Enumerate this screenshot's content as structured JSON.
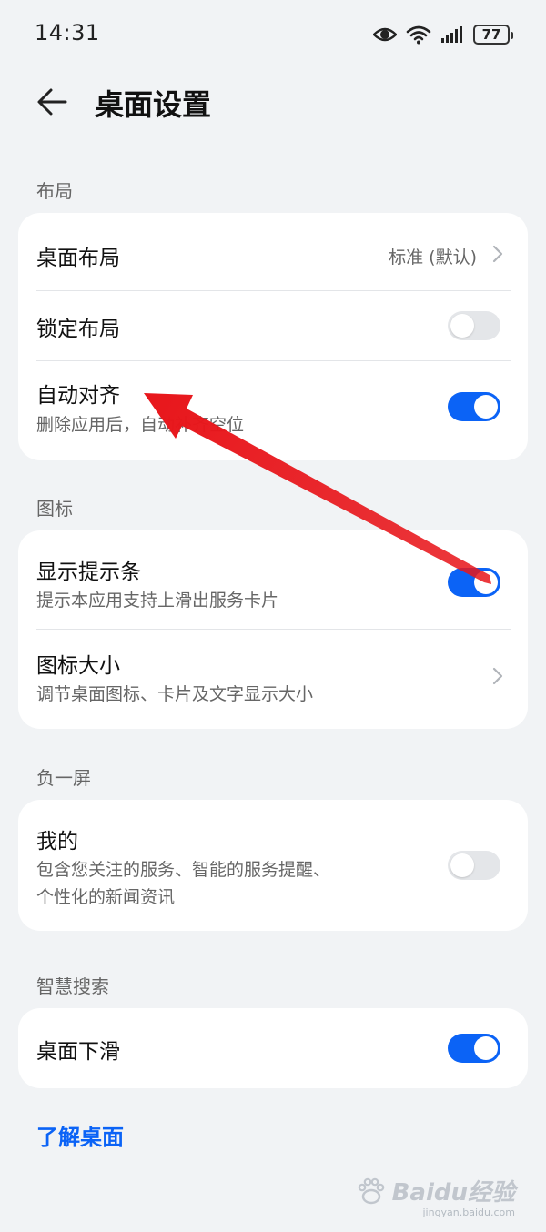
{
  "status_bar": {
    "time": "14:31",
    "battery": "77"
  },
  "header": {
    "title": "桌面设置"
  },
  "sections": {
    "layout": {
      "label": "布局",
      "rows": {
        "desktop_layout": {
          "title": "桌面布局",
          "value": "标准 (默认)"
        },
        "lock_layout": {
          "title": "锁定布局",
          "toggle": false
        },
        "auto_align": {
          "title": "自动对齐",
          "subtitle": "删除应用后，自动补齐空位",
          "toggle": true
        }
      }
    },
    "icons": {
      "label": "图标",
      "rows": {
        "show_hint_bar": {
          "title": "显示提示条",
          "subtitle": "提示本应用支持上滑出服务卡片",
          "toggle": true
        },
        "icon_size": {
          "title": "图标大小",
          "subtitle": "调节桌面图标、卡片及文字显示大小"
        }
      }
    },
    "minus_one": {
      "label": "负一屏",
      "rows": {
        "mine": {
          "title": "我的",
          "subtitle_line1": "包含您关注的服务、智能的服务提醒、",
          "subtitle_line2": "个性化的新闻资讯",
          "toggle": false
        }
      }
    },
    "smart_search": {
      "label": "智慧搜索",
      "rows": {
        "desktop_swipe_down": {
          "title": "桌面下滑",
          "toggle": true
        }
      }
    }
  },
  "footer": {
    "link": "了解桌面"
  },
  "watermark": {
    "text": "Baidu经验",
    "sub": "jingyan.baidu.com"
  },
  "colors": {
    "accent": "#0b63f6",
    "annotation_arrow": "#e8161b",
    "background": "#f1f3f5"
  }
}
